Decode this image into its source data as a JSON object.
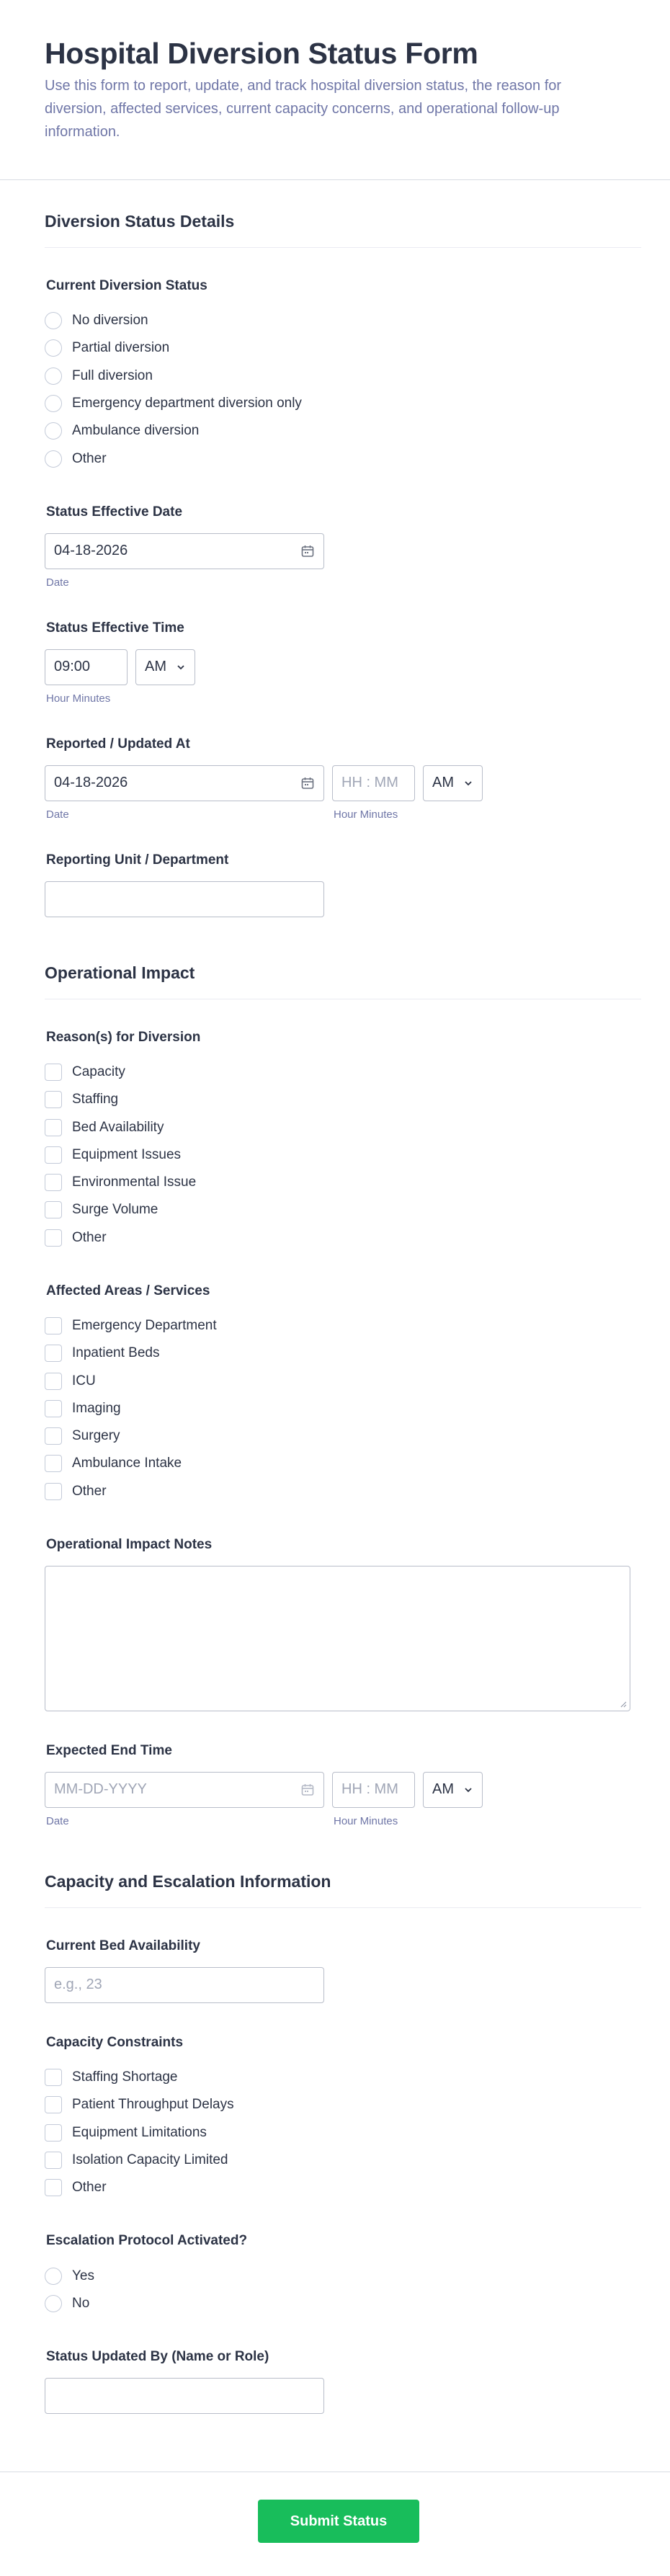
{
  "form": {
    "title": "Hospital Diversion Status Form",
    "description": "Use this form to report, update, and track hospital diversion status, the reason for diversion, affected services, current capacity concerns, and operational follow-up information."
  },
  "section1": {
    "heading": "Diversion Status Details",
    "current_status": {
      "label": "Current Diversion Status",
      "options": [
        "No diversion",
        "Partial diversion",
        "Full diversion",
        "Emergency department diversion only",
        "Ambulance diversion",
        "Other"
      ]
    },
    "effective_date": {
      "label": "Status Effective Date",
      "value": "04-18-2026",
      "sublabel": "Date"
    },
    "effective_time": {
      "label": "Status Effective Time",
      "value": "09:00",
      "ampm": "AM",
      "sublabel": "Hour Minutes"
    },
    "reported_at": {
      "label": "Reported / Updated At",
      "date_value": "04-18-2026",
      "time_placeholder": "HH : MM",
      "ampm": "AM",
      "date_sublabel": "Date",
      "time_sublabel": "Hour Minutes"
    },
    "reporting_unit": {
      "label": "Reporting Unit / Department",
      "value": ""
    }
  },
  "section2": {
    "heading": "Operational Impact",
    "reasons": {
      "label": "Reason(s) for Diversion",
      "options": [
        "Capacity",
        "Staffing",
        "Bed Availability",
        "Equipment Issues",
        "Environmental Issue",
        "Surge Volume",
        "Other"
      ]
    },
    "areas": {
      "label": "Affected Areas / Services",
      "options": [
        "Emergency Department",
        "Inpatient Beds",
        "ICU",
        "Imaging",
        "Surgery",
        "Ambulance Intake",
        "Other"
      ]
    },
    "notes": {
      "label": "Operational Impact Notes",
      "value": ""
    },
    "expected_end": {
      "label": "Expected End Time",
      "date_placeholder": "MM-DD-YYYY",
      "time_placeholder": "HH : MM",
      "ampm": "AM",
      "date_sublabel": "Date",
      "time_sublabel": "Hour Minutes"
    }
  },
  "section3": {
    "heading": "Capacity and Escalation Information",
    "bed_availability": {
      "label": "Current Bed Availability",
      "placeholder": "e.g., 23"
    },
    "constraints": {
      "label": "Capacity Constraints",
      "options": [
        "Staffing Shortage",
        "Patient Throughput Delays",
        "Equipment Limitations",
        "Isolation Capacity Limited",
        "Other"
      ]
    },
    "escalation": {
      "label": "Escalation Protocol Activated?",
      "options": [
        "Yes",
        "No"
      ]
    },
    "updated_by": {
      "label": "Status Updated By (Name or Role)",
      "value": ""
    }
  },
  "submit_label": "Submit Status",
  "colors": {
    "accent": "#18bd5b",
    "text": "#2c3345",
    "muted": "#6f76a7",
    "border": "#b8bdc9"
  }
}
